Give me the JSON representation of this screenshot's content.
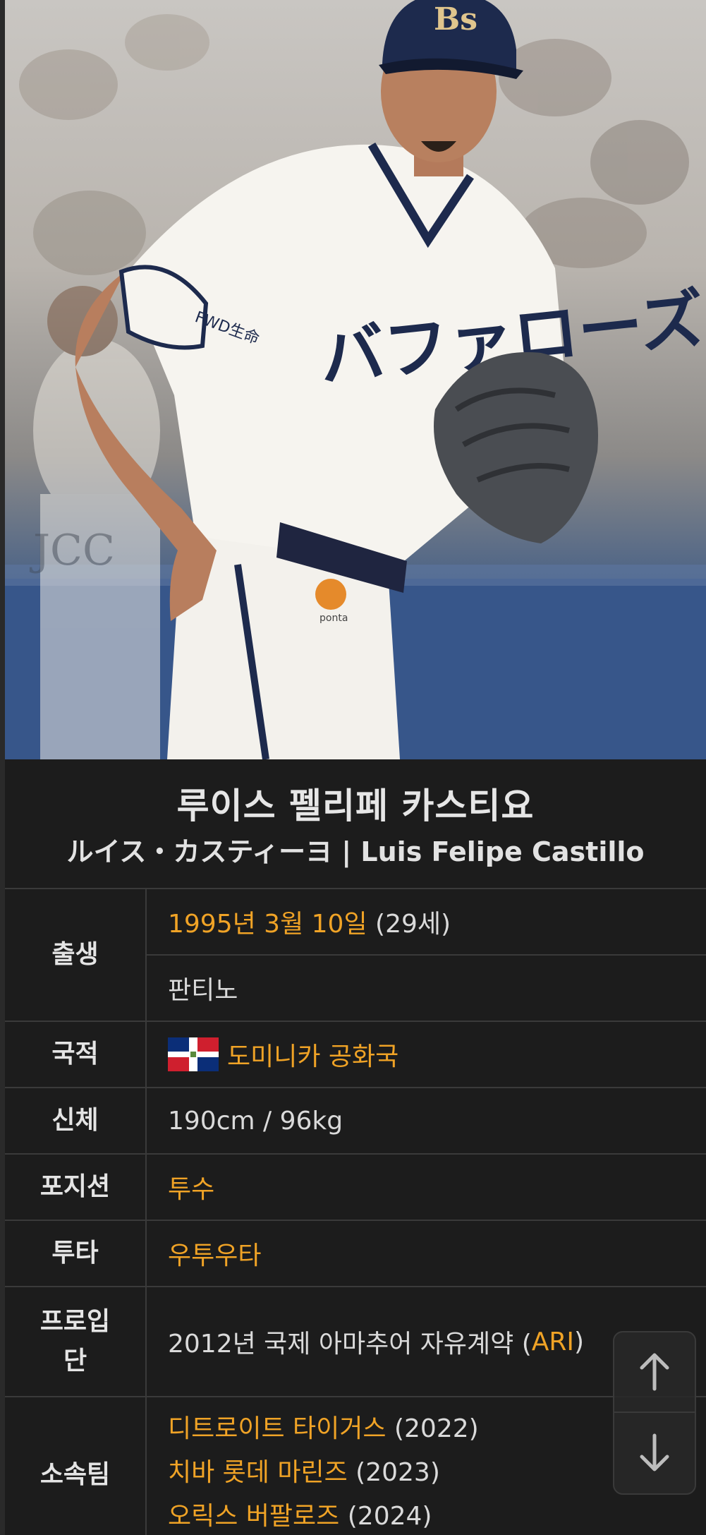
{
  "player": {
    "name_ko": "루이스 펠리페 카스티요",
    "name_alt": "ルイス・カスティーヨ | Luis Felipe Castillo"
  },
  "photo": {
    "cap_mark": "Bs",
    "jersey_text": "バファローズ",
    "sleeve_patch": "FWD生命",
    "mascot_text": "ponta"
  },
  "infobox": {
    "birth": {
      "label": "출생",
      "date": "1995년 3월 10일",
      "age": " (29세)",
      "place": "판티노"
    },
    "nationality": {
      "label": "국적",
      "value": "도미니카 공화국",
      "flag_icon": "dominican-republic-flag-icon"
    },
    "body": {
      "label": "신체",
      "value": "190cm / 96kg"
    },
    "position": {
      "label": "포지션",
      "value": "투수"
    },
    "bats_throws": {
      "label": "투타",
      "value": "우투우타"
    },
    "pro_entry": {
      "label_line1": "프로입",
      "label_line2": "단",
      "text": "2012년 국제 아마추어 자유계약 (",
      "team": "ARI",
      "close": ")"
    },
    "teams": {
      "label": "소속팀",
      "items": [
        {
          "name": "디트로이트 타이거스",
          "year": " (2022)"
        },
        {
          "name": "치바 롯데 마린즈",
          "year": " (2023)"
        },
        {
          "name": "오릭스 버팔로즈",
          "year": " (2024)"
        }
      ]
    }
  },
  "colors": {
    "link": "#f0a326",
    "background": "#1c1c1c",
    "border": "#3a3a3a",
    "text": "#dadada"
  },
  "controls": {
    "up_icon": "arrow-up-icon",
    "down_icon": "arrow-down-icon"
  }
}
